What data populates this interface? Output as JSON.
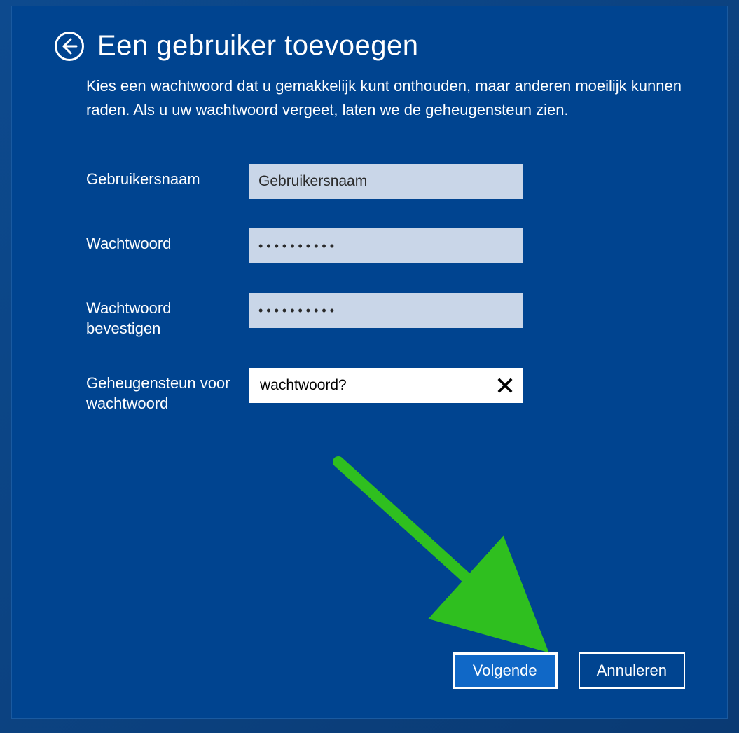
{
  "header": {
    "title": "Een gebruiker toevoegen"
  },
  "description": "Kies een wachtwoord dat u gemakkelijk kunt onthouden, maar anderen moeilijk kunnen raden. Als u uw wachtwoord vergeet, laten we de geheugensteun zien.",
  "form": {
    "username": {
      "label": "Gebruikersnaam",
      "value": "Gebruikersnaam"
    },
    "password": {
      "label": "Wachtwoord",
      "value": "••••••••••"
    },
    "confirm": {
      "label": "Wachtwoord bevestigen",
      "value": "••••••••••"
    },
    "hint": {
      "label": "Geheugensteun voor wachtwoord",
      "value": "wachtwoord?"
    }
  },
  "footer": {
    "next": "Volgende",
    "cancel": "Annuleren"
  }
}
